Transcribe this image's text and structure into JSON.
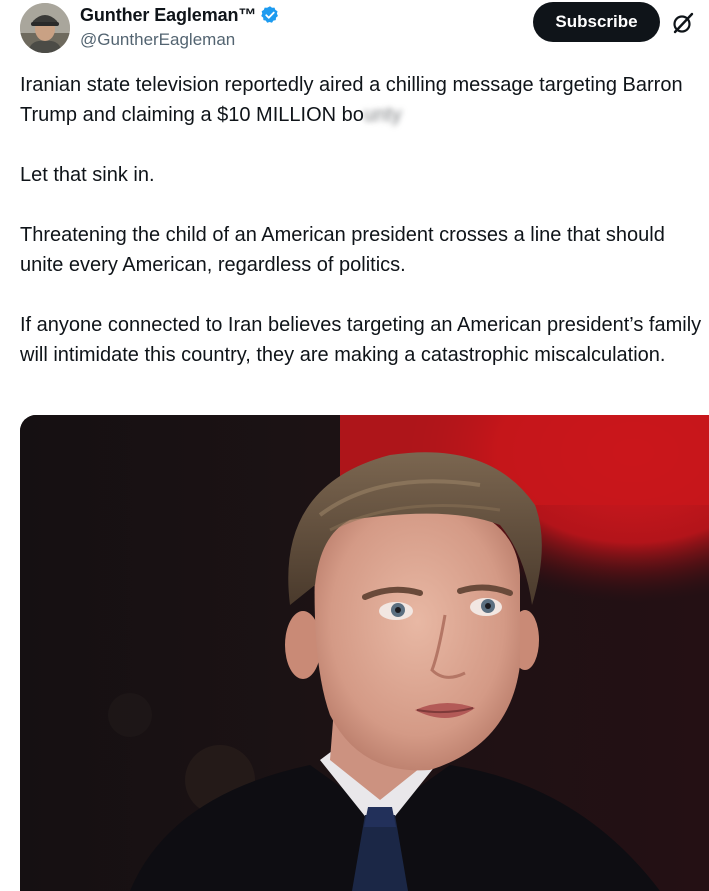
{
  "author": {
    "name": "Gunther Eagleman™",
    "handle": "@GuntherEagleman",
    "verified": true,
    "badge_color": "#1d9bf0"
  },
  "actions": {
    "subscribe_label": "Subscribe"
  },
  "icons": {
    "avatar": "avatar-photo",
    "verified": "verified-badge-icon",
    "grok": "grok-icon"
  },
  "tweet": {
    "paragraphs": [
      {
        "text": "Iranian state television reportedly aired a chilling message targeting Barron Trump and claiming a $10 MILLION bo",
        "obscured_tail": "unty"
      },
      {
        "text": "Let that sink in."
      },
      {
        "text": "Threatening the child of an American president crosses a line that should unite every American, regardless of politics."
      },
      {
        "text": "If anyone connected to Iran believes targeting an American president’s family will intimidate this country, they are making a catastrophic miscalculation."
      }
    ]
  },
  "media": {
    "kind": "photo",
    "subject": "young-man-portrait"
  },
  "colors": {
    "text": "#0f1419",
    "secondary": "#536471",
    "button_bg": "#0f1419",
    "photo_red": "#c8161b"
  }
}
